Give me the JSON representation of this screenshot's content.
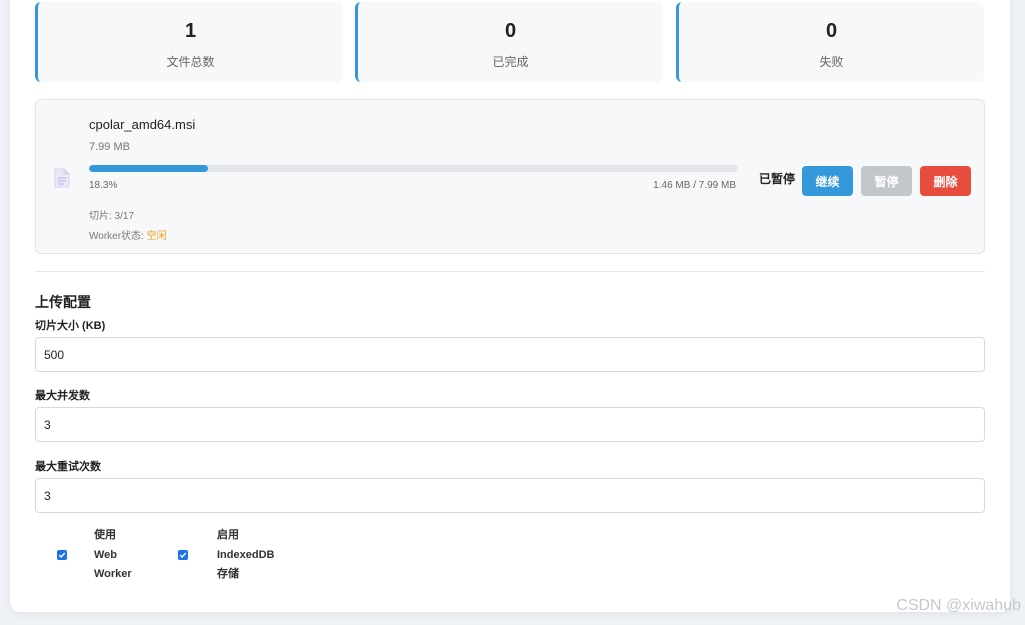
{
  "stats": [
    {
      "value": "1",
      "label": "文件总数"
    },
    {
      "value": "0",
      "label": "已完成"
    },
    {
      "value": "0",
      "label": "失败"
    }
  ],
  "file": {
    "name": "cpolar_amd64.msi",
    "size": "7.99 MB",
    "progress": 0.183,
    "percent": "18.3%",
    "transferred": "1.46 MB / 7.99 MB",
    "chunks": "切片: 3/17",
    "worker_label": "Worker状态: ",
    "worker_state": "空闲",
    "status": "已暂停",
    "buttons": {
      "resume": "继续",
      "pause": "暂停",
      "delete": "删除"
    }
  },
  "config": {
    "title": "上传配置",
    "chunk_size_label": "切片大小 (KB)",
    "chunk_size_value": "500",
    "max_concurrency_label": "最大并发数",
    "max_concurrency_value": "3",
    "max_retries_label": "最大重试次数",
    "max_retries_value": "3",
    "use_web_worker": {
      "checked": true,
      "line1": "使用",
      "line2": "Web",
      "line3": "Worker"
    },
    "use_indexeddb": {
      "checked": true,
      "line1": "启用",
      "line2": "IndexedDB",
      "line3": "存储"
    }
  },
  "watermark": "CSDN @xiwahub",
  "colors": {
    "accent": "#3498db",
    "danger": "#e74c3c",
    "disabled": "#c3c7cc",
    "warning": "#f39c12"
  }
}
